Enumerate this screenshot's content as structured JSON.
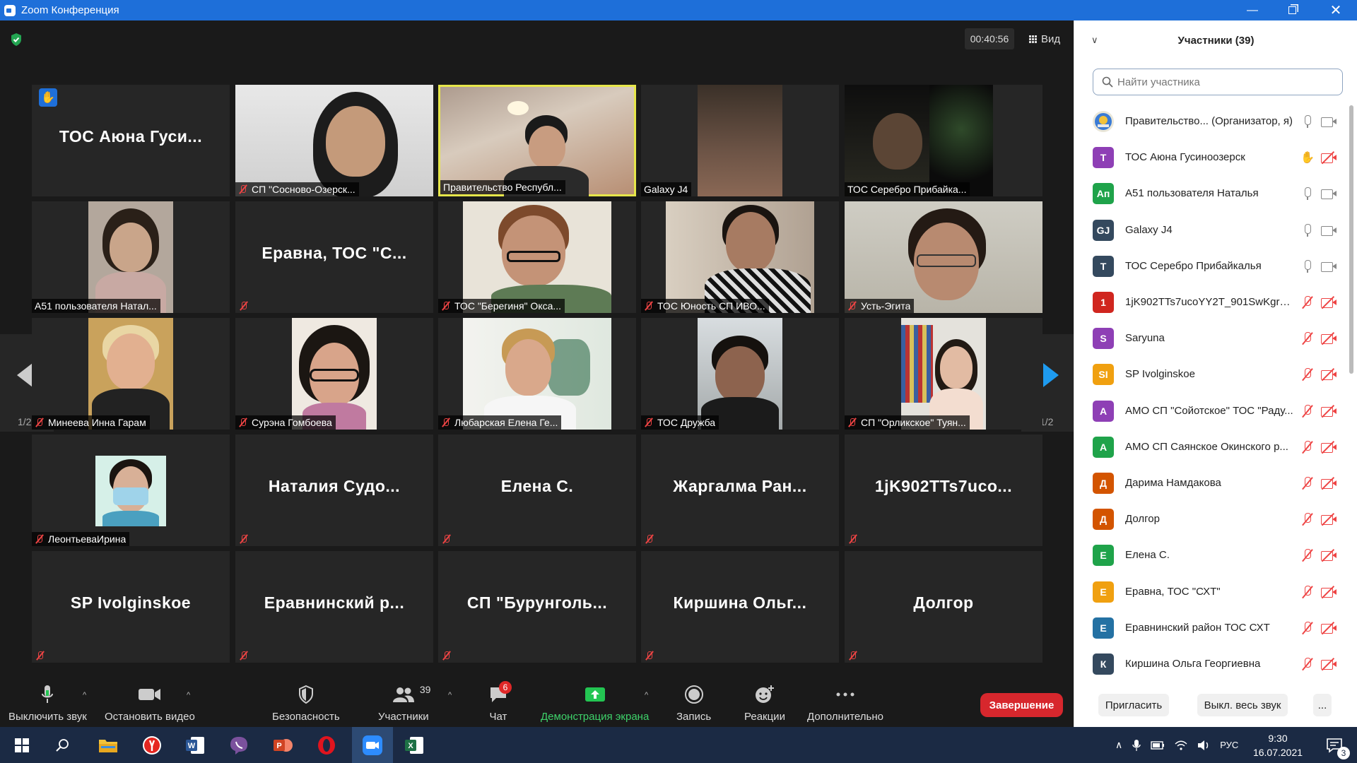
{
  "window": {
    "title": "Zoom Конференция"
  },
  "meeting": {
    "timer": "00:40:56",
    "view_label": "Вид",
    "page_indicator_left": "1/2",
    "page_indicator_right": "1/2"
  },
  "tiles": [
    {
      "name": "ТОС Аюна Гуси...",
      "type": "name",
      "hand_raised": true
    },
    {
      "name": "СП \"Сосново-Озерск...",
      "type": "video",
      "muted": true
    },
    {
      "name": "Правительство Республ...",
      "type": "video",
      "muted": false,
      "active": true
    },
    {
      "name": "Galaxy J4",
      "type": "video",
      "muted": false
    },
    {
      "name": "ТОС Серебро Прибайка...",
      "type": "video",
      "muted": false
    },
    {
      "name": "А51 пользователя Натал...",
      "type": "video",
      "muted": false
    },
    {
      "name": "Еравна,  ТОС  \"С...",
      "type": "name",
      "muted": true
    },
    {
      "name": "ТОС \"Берегиня\" Окса...",
      "type": "video",
      "muted": true
    },
    {
      "name": "ТОС Юность СП ИВО...",
      "type": "video",
      "muted": true
    },
    {
      "name": "Усть-Эгита",
      "type": "video",
      "muted": true
    },
    {
      "name": "Минеева Инна Гарам",
      "type": "video",
      "muted": true
    },
    {
      "name": "Сурэна Гомбоева",
      "type": "video",
      "muted": true
    },
    {
      "name": "Любарская Елена Ге...",
      "type": "video",
      "muted": true
    },
    {
      "name": "ТОС Дружба",
      "type": "video",
      "muted": true
    },
    {
      "name": "СП \"Орликское\" Туян...",
      "type": "video",
      "muted": true
    },
    {
      "name": "ЛеонтьеваИрина",
      "type": "video",
      "muted": true
    },
    {
      "name": "Наталия   Судо...",
      "type": "name",
      "muted": true
    },
    {
      "name": "Елена С.",
      "type": "name",
      "muted": true
    },
    {
      "name": "Жаргалма  Ран...",
      "type": "name",
      "muted": true
    },
    {
      "name": "1jK902TTs7uco...",
      "type": "name",
      "muted": true
    },
    {
      "name": "SP Ivolginskoe",
      "type": "name",
      "muted": true
    },
    {
      "name": "Еравнинский  р...",
      "type": "name",
      "muted": true
    },
    {
      "name": "СП  \"Бурунголь...",
      "type": "name",
      "muted": true
    },
    {
      "name": "Киршина  Ольг...",
      "type": "name",
      "muted": true
    },
    {
      "name": "Долгор",
      "type": "name",
      "muted": true
    }
  ],
  "toolbar": {
    "mute_label": "Выключить звук",
    "video_label": "Остановить видео",
    "security_label": "Безопасность",
    "participants_label": "Участники",
    "participants_count": "39",
    "chat_label": "Чат",
    "chat_badge": "6",
    "share_label": "Демонстрация экрана",
    "record_label": "Запись",
    "reactions_label": "Реакции",
    "more_label": "Дополнительно",
    "end_label": "Завершение"
  },
  "panel": {
    "title": "Участники (39)",
    "search_placeholder": "Найти участника",
    "participants": [
      {
        "initials": "",
        "color": "#e9e6d8",
        "name": "Правительство...  (Организатор, я)",
        "mic": "on",
        "cam": "on",
        "hand": false,
        "logo": true
      },
      {
        "initials": "Т",
        "color": "#8e3fb5",
        "name": "ТОС Аюна Гусиноозерск",
        "mic": "hand",
        "cam": "off",
        "hand": true
      },
      {
        "initials": "Ап",
        "color": "#1fa34a",
        "name": "А51 пользователя Наталья",
        "mic": "on",
        "cam": "on"
      },
      {
        "initials": "GJ",
        "color": "#34495e",
        "name": "Galaxy J4",
        "mic": "on",
        "cam": "on"
      },
      {
        "initials": "Т",
        "color": "#34495e",
        "name": "ТОС Серебро Прибайкалья",
        "mic": "on",
        "cam": "on"
      },
      {
        "initials": "1",
        "color": "#d0261f",
        "name": "1jK902TTs7ucoYY2T_901SwKgrA...",
        "mic": "off",
        "cam": "off"
      },
      {
        "initials": "S",
        "color": "#8e3fb5",
        "name": "Saryuna",
        "mic": "off",
        "cam": "off"
      },
      {
        "initials": "SI",
        "color": "#f0a010",
        "name": "SP Ivolginskoe",
        "mic": "off",
        "cam": "off"
      },
      {
        "initials": "А",
        "color": "#8e3fb5",
        "name": "АМО СП \"Сойотское\" ТОС \"Раду...",
        "mic": "off",
        "cam": "off"
      },
      {
        "initials": "А",
        "color": "#1fa34a",
        "name": "АМО СП Саянское Окинского р...",
        "mic": "off",
        "cam": "off"
      },
      {
        "initials": "Д",
        "color": "#d35400",
        "name": "Дарима Намдакова",
        "mic": "off",
        "cam": "off"
      },
      {
        "initials": "Д",
        "color": "#d35400",
        "name": "Долгор",
        "mic": "off",
        "cam": "off"
      },
      {
        "initials": "Е",
        "color": "#1fa34a",
        "name": "Елена С.",
        "mic": "off",
        "cam": "off"
      },
      {
        "initials": "Е",
        "color": "#f0a010",
        "name": "Еравна, ТОС \"СХТ\"",
        "mic": "off",
        "cam": "off"
      },
      {
        "initials": "Е",
        "color": "#2471a3",
        "name": "Еравнинский район ТОС СХТ",
        "mic": "off",
        "cam": "off"
      },
      {
        "initials": "К",
        "color": "#34495e",
        "name": "Киршина Ольга Георгиевна",
        "mic": "off",
        "cam": "off"
      }
    ],
    "invite_label": "Пригласить",
    "mute_all_label": "Выкл. весь звук",
    "more_label": "..."
  },
  "taskbar": {
    "lang": "РУС",
    "time": "9:30",
    "date": "16.07.2021",
    "notif_count": "3"
  }
}
